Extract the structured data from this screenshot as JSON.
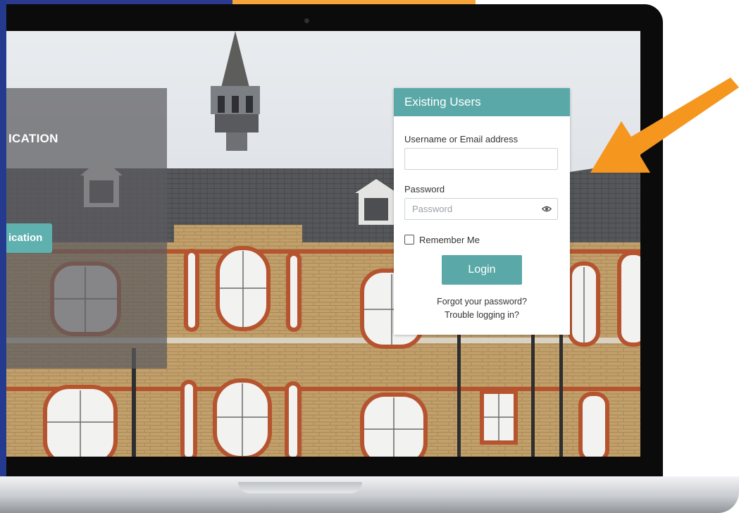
{
  "colors": {
    "accent": "#5aa9a8",
    "panel_overlay": "#5c5c60",
    "arrow": "#f5961f",
    "frame_blue": "#243a8e"
  },
  "left_panel": {
    "heading_fragment": "ICATION",
    "button_fragment": "ication"
  },
  "login": {
    "header": "Existing Users",
    "username_label": "Username or Email address",
    "username_value": "",
    "password_label": "Password",
    "password_placeholder": "Password",
    "show_password_icon": "eye-icon",
    "remember_label": "Remember Me",
    "login_button": "Login",
    "forgot_link": "Forgot your password?",
    "trouble_link": "Trouble logging in?"
  },
  "annotation": {
    "arrow_icon": "arrow-icon"
  }
}
